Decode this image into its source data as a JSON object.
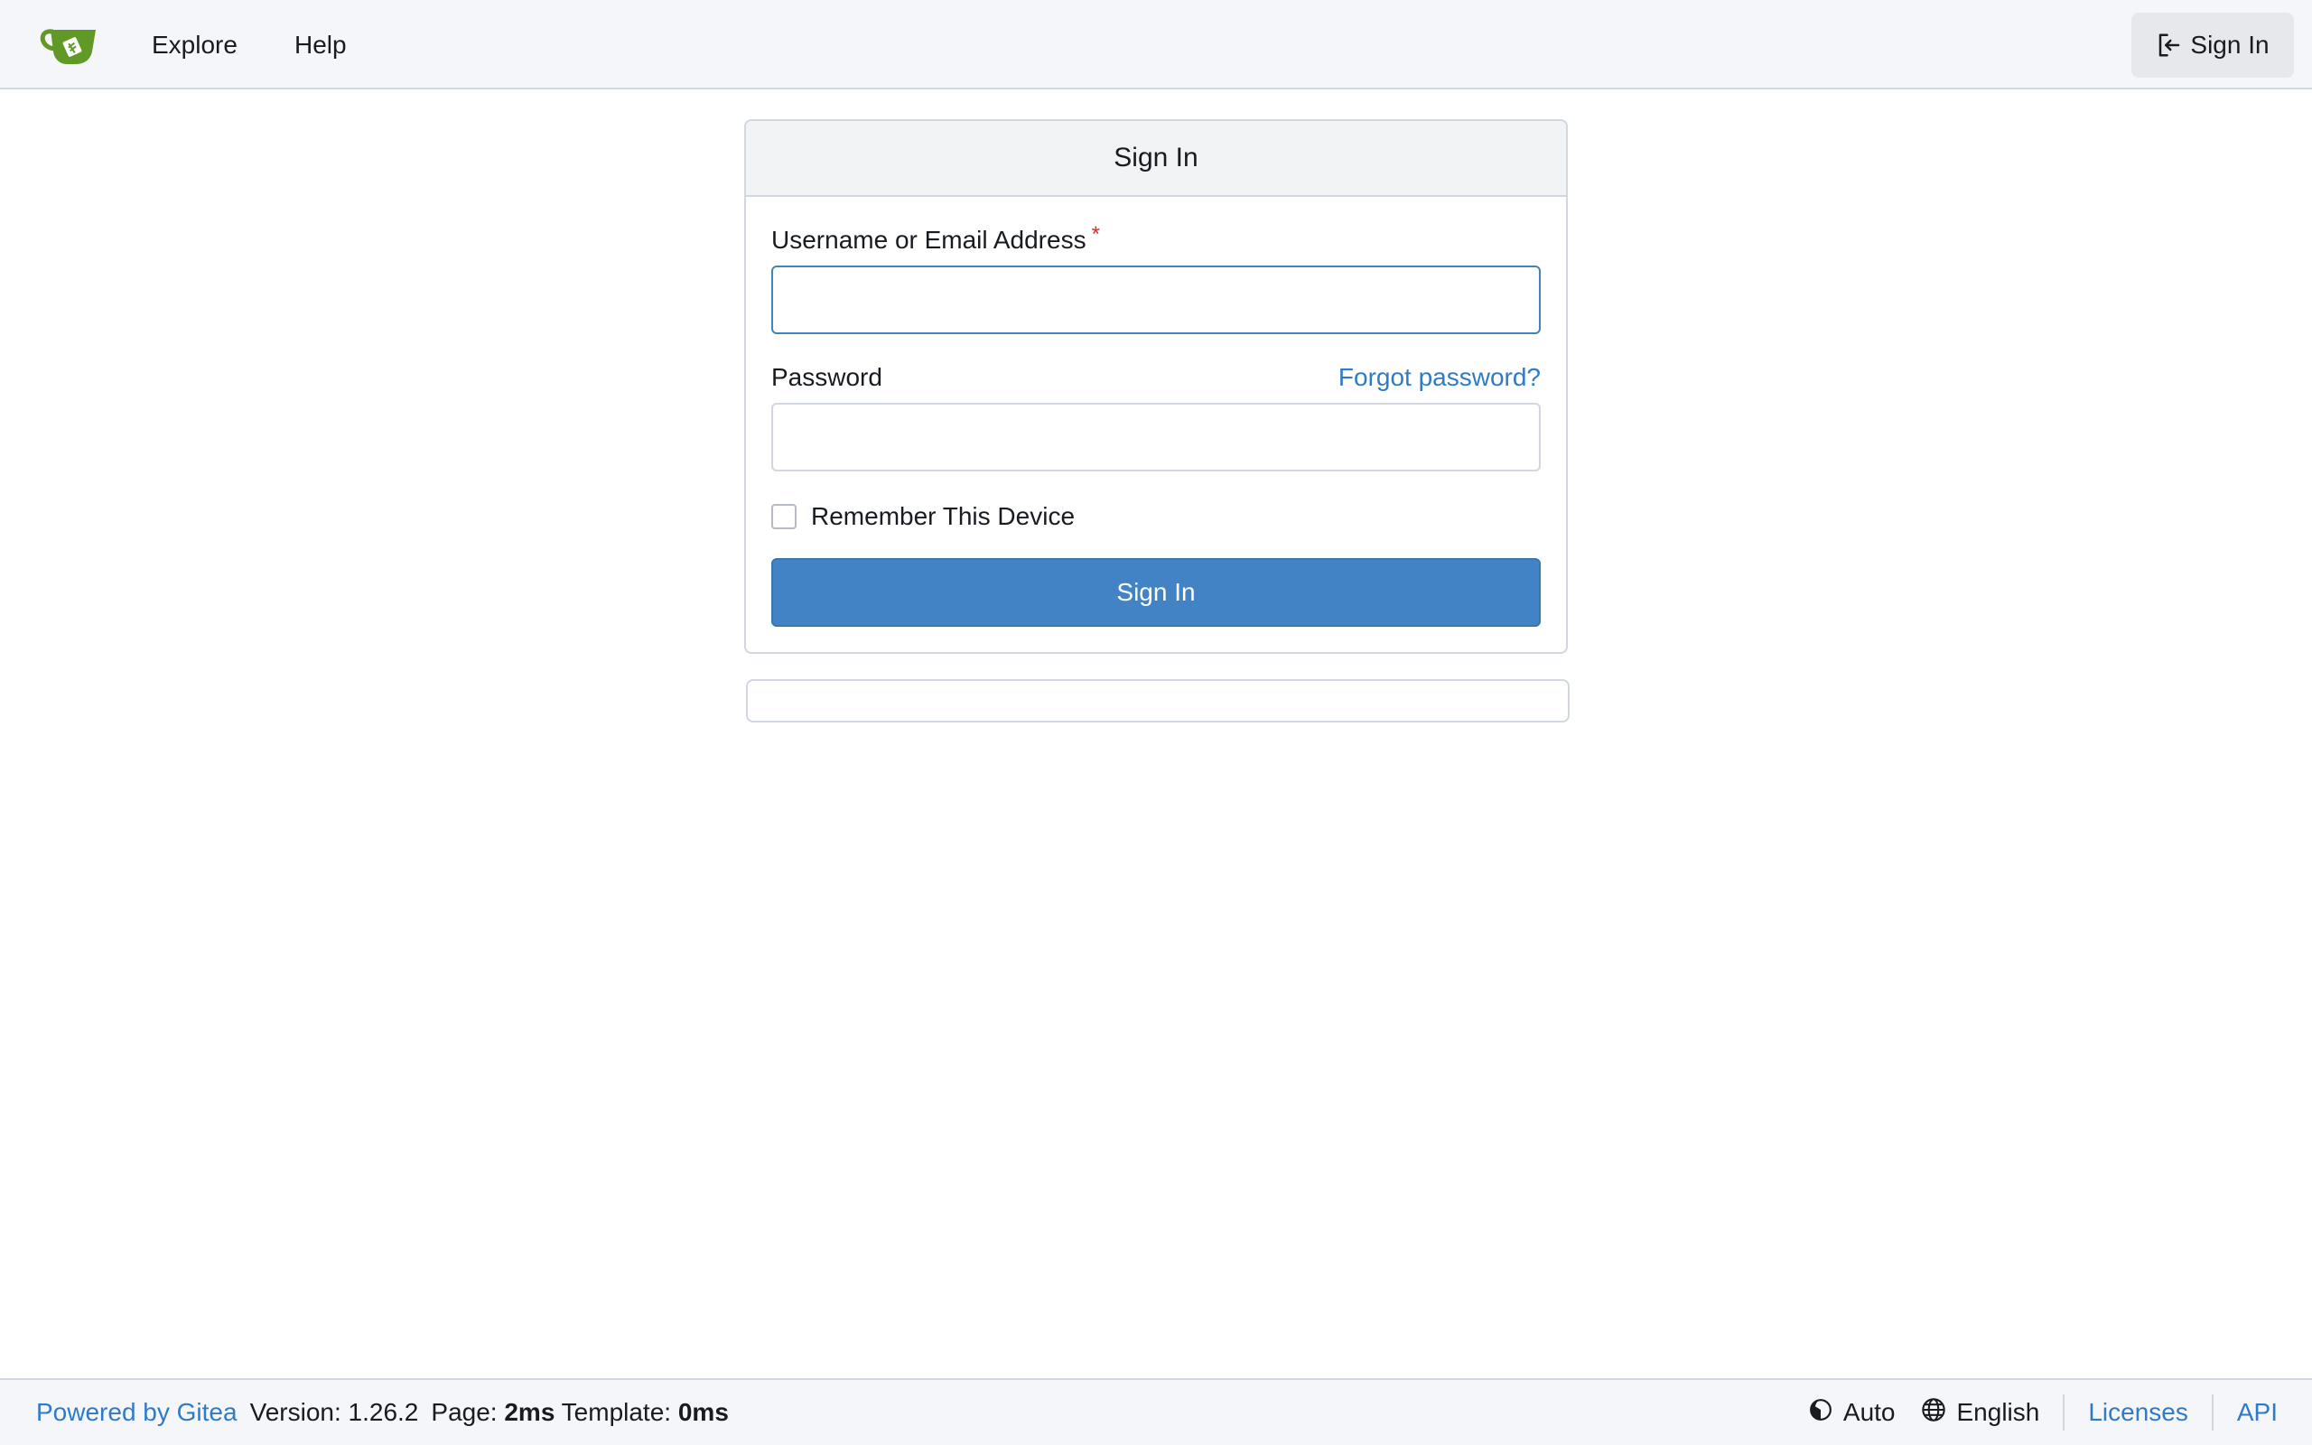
{
  "navbar": {
    "logo_icon": "gitea-teacup-logo-icon",
    "links": [
      "Explore",
      "Help"
    ],
    "signin_label": "Sign In",
    "signin_icon": "sign-in-icon"
  },
  "signin_card": {
    "title": "Sign In",
    "username_label": "Username or Email Address",
    "required_marker": "*",
    "username_value": "",
    "password_label": "Password",
    "password_value": "",
    "forgot_password_label": "Forgot password?",
    "remember_label": "Remember This Device",
    "remember_checked": false,
    "submit_label": "Sign In"
  },
  "footer": {
    "powered_by": "Powered by Gitea",
    "version_label": "Version:",
    "version_value": "1.26.2",
    "page_label": "Page:",
    "page_value": "2ms",
    "template_label": "Template:",
    "template_value": "0ms",
    "theme_label": "Auto",
    "theme_icon": "theme-contrast-icon",
    "language_label": "English",
    "language_icon": "globe-icon",
    "licenses_label": "Licenses",
    "api_label": "API"
  },
  "colors": {
    "accent": "#4183c4",
    "link": "#2f7bc7",
    "logo_green": "#609926",
    "required": "#db2828"
  }
}
